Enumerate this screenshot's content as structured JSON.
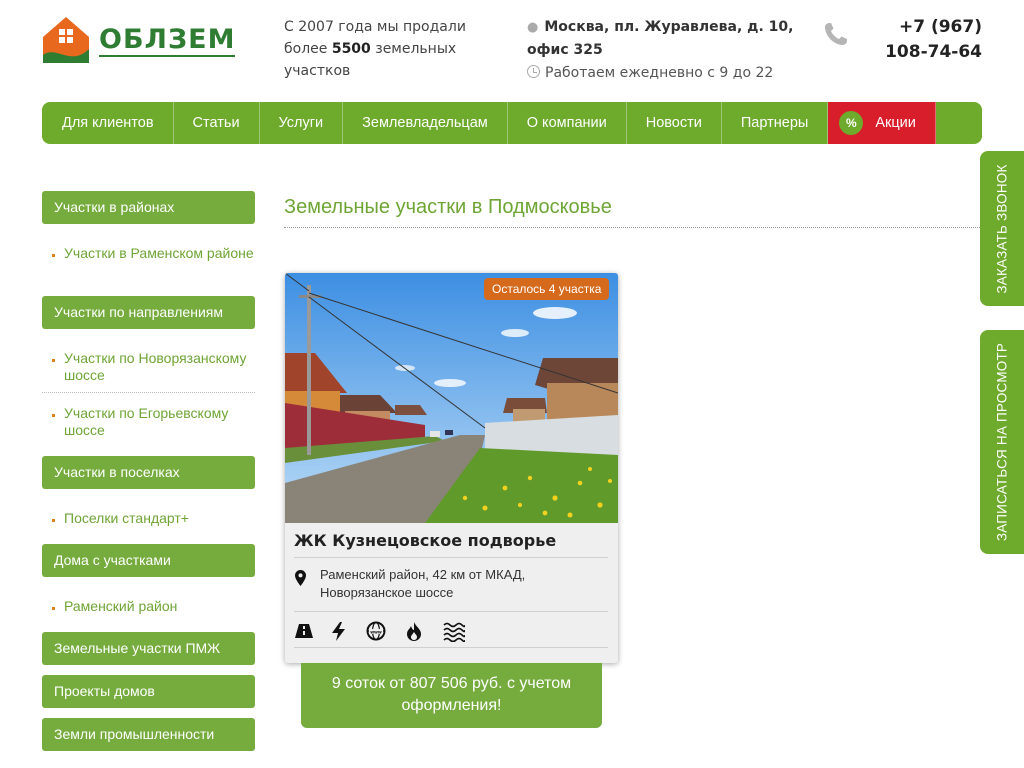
{
  "header": {
    "logo_text": "ОБЛЗЕМ",
    "sold_text": "С 2007 года мы продали более",
    "sold_count": "5500",
    "sold_suffix": "земельных участков",
    "address": "Москва, пл. Журавлева, д. 10, офис 325",
    "hours": "Работаем ежедневно с 9 до 22",
    "phone": "+7 (967) 108-74-64"
  },
  "nav": {
    "items": [
      "Для клиентов",
      "Статьи",
      "Услуги",
      "Землевладельцам",
      "О компании",
      "Новости",
      "Партнеры"
    ],
    "promo_badge": "%",
    "promo_label": "Акции"
  },
  "sidebar": {
    "categories": [
      {
        "label": "Участки в районах",
        "links": [
          "Участки в Раменском районе"
        ]
      },
      {
        "label": "Участки по направлениям",
        "links": [
          "Участки по Новорязанскому шоссе",
          "Участки по Егорьевскому шоссе"
        ]
      },
      {
        "label": "Участки в поселках",
        "links": [
          "Поселки стандарт+"
        ]
      },
      {
        "label": "Дома с участками",
        "links": [
          "Раменский район"
        ]
      },
      {
        "label": "Земельные участки ПМЖ",
        "links": []
      },
      {
        "label": "Проекты домов",
        "links": []
      },
      {
        "label": "Земли промышленности",
        "links": []
      }
    ]
  },
  "main": {
    "title": "Земельные участки в Подмосковье",
    "card": {
      "badge": "Осталось 4 участка",
      "title": "ЖК Кузнецовское подворье",
      "address": "Раменский район, 42 км от МКАД, Новорязанское шоссе",
      "amenities": [
        "road-icon",
        "electricity-icon",
        "internet-icon",
        "gas-icon",
        "water-icon"
      ],
      "price": "9 соток от 807 506 руб. с учетом оформления!"
    }
  },
  "side_tabs": {
    "call": "ЗАКАЗАТЬ ЗВОНОК",
    "viewing": "ЗАПИСАТЬСЯ НА ПРОСМОТР"
  },
  "colors": {
    "brand_green": "#6eaa2c",
    "sidebar_green": "#76ac3e",
    "link_green": "#6ea535",
    "promo_red": "#d81e2a",
    "badge_orange": "#d5691c"
  }
}
